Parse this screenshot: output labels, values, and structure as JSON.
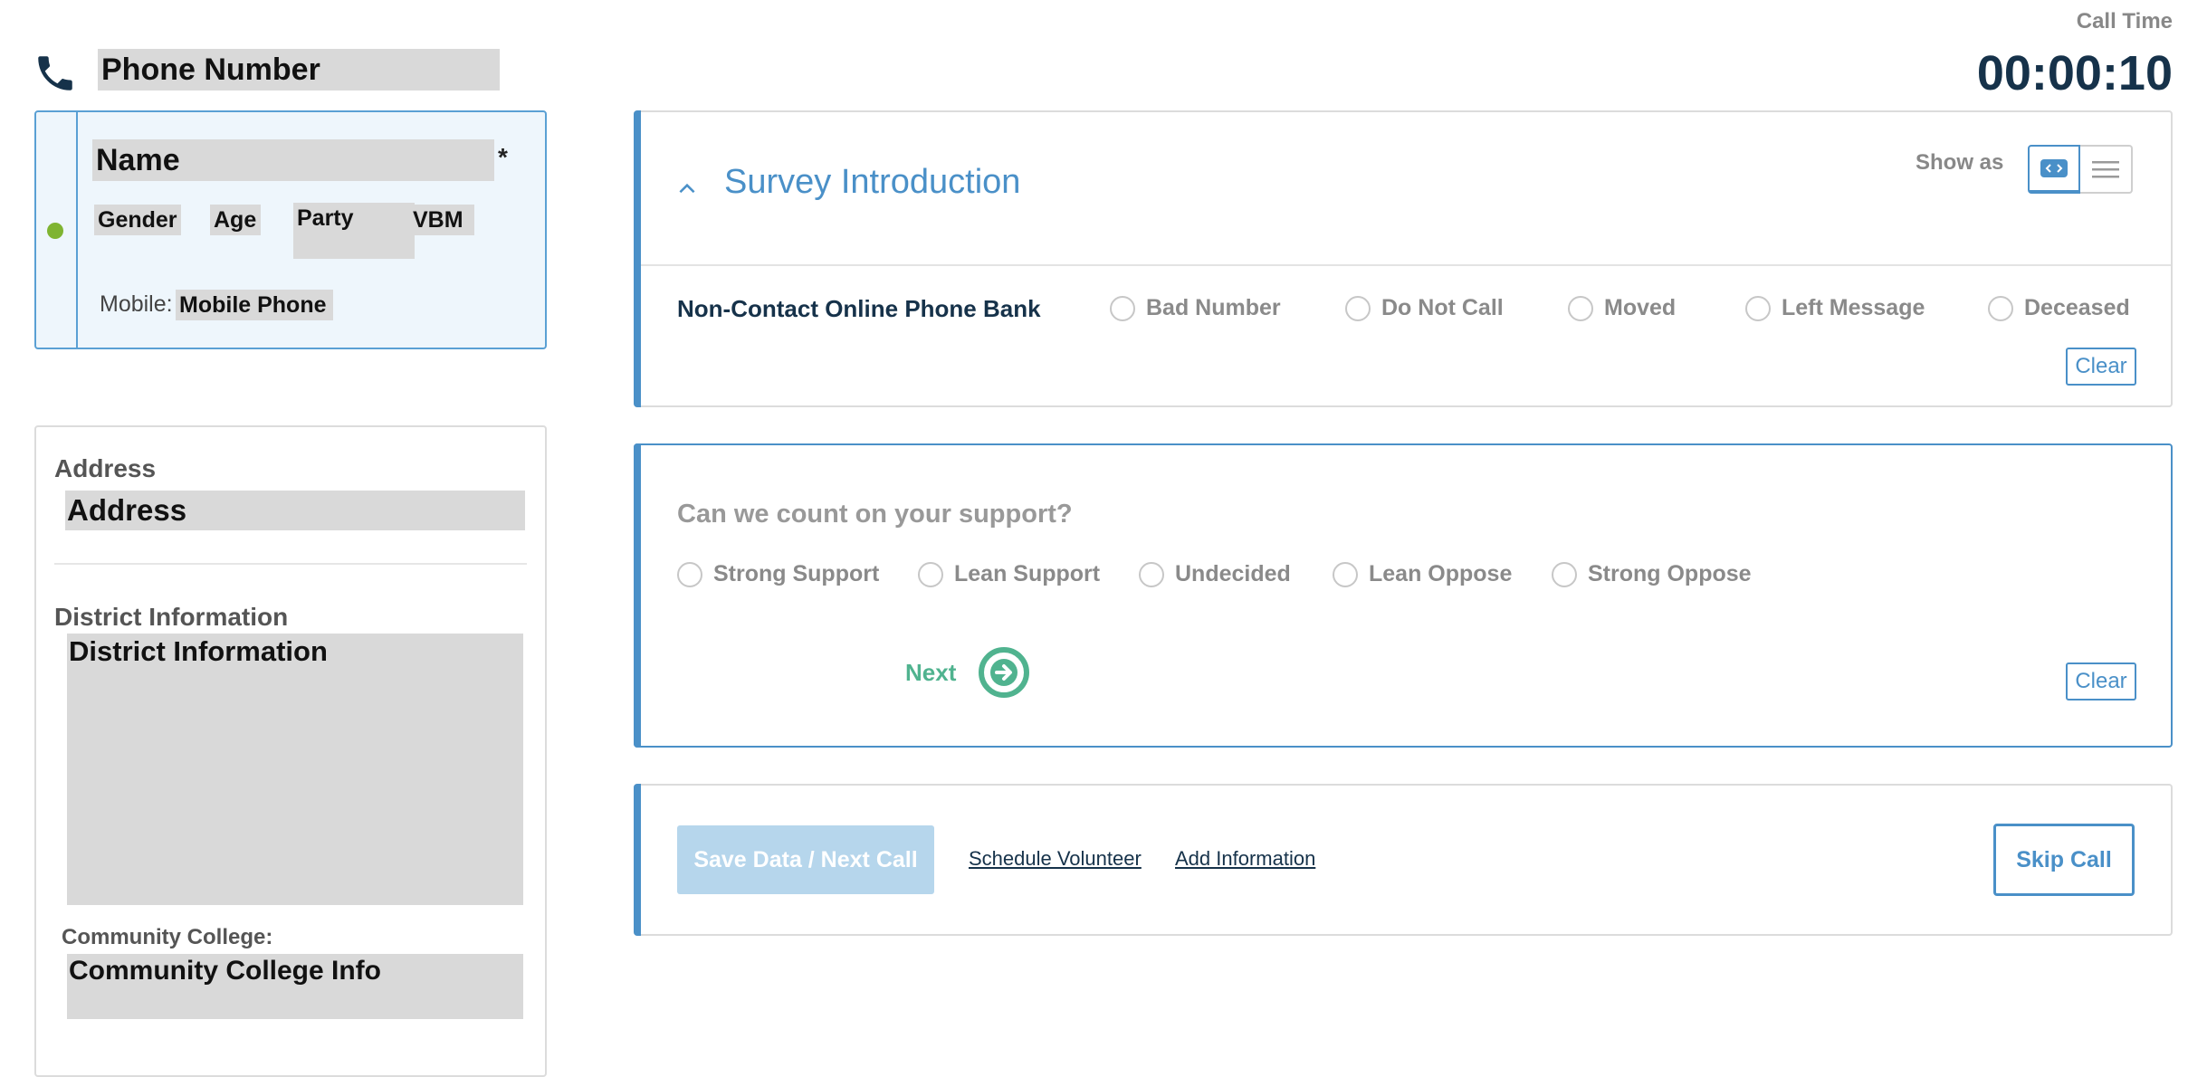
{
  "header": {
    "phone_label": "Phone Number",
    "call_time_label": "Call Time",
    "call_time_value": "00:00:10"
  },
  "contact": {
    "name": "Name",
    "required_mark": "*",
    "gender": "Gender",
    "age": "Age",
    "party": "Party",
    "vbm": "VBM",
    "mobile_label": "Mobile:",
    "mobile_value": "Mobile Phone",
    "status_color": "#7fb431"
  },
  "address_panel": {
    "address_label": "Address",
    "address_value": "Address",
    "district_label": "District Information",
    "district_value": "District Information",
    "community_college_label": "Community College:",
    "community_college_value": "Community College Info"
  },
  "survey": {
    "title": "Survey Introduction",
    "show_as_label": "Show as",
    "non_contact_label": "Non-Contact Online Phone Bank",
    "non_contact_options": [
      "Bad Number",
      "Do Not Call",
      "Moved",
      "Left Message",
      "Deceased"
    ],
    "clear_label": "Clear"
  },
  "question": {
    "text": "Can we count on your support?",
    "options": [
      "Strong Support",
      "Lean Support",
      "Undecided",
      "Lean Oppose",
      "Strong Oppose"
    ],
    "next_label": "Next",
    "clear_label": "Clear"
  },
  "actions": {
    "save_label": "Save Data / Next Call",
    "schedule_label": "Schedule Volunteer",
    "add_info_label": "Add Information",
    "skip_label": "Skip Call"
  },
  "colors": {
    "accent": "#4a90c8",
    "dark_text": "#16324a",
    "next_green": "#50b38f"
  },
  "icons": {
    "phone": "phone-icon",
    "collapse": "chevron-up-icon",
    "card_view": "card-view-icon",
    "list_view": "list-view-icon",
    "next": "arrow-right-circle-icon"
  }
}
